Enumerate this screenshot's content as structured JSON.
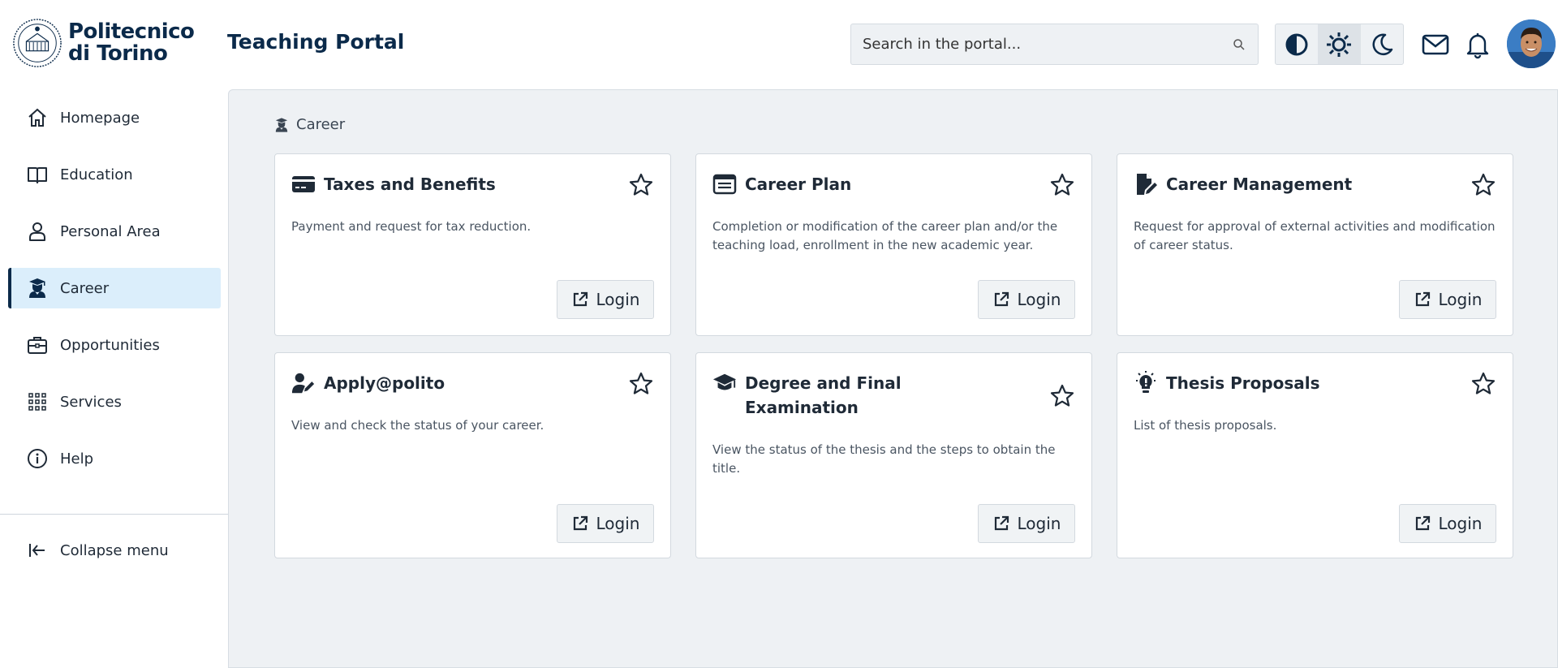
{
  "header": {
    "logo_line1": "Politecnico",
    "logo_line2": "di Torino",
    "portal_title": "Teaching Portal",
    "search_placeholder": "Search in the portal...",
    "theme_modes": [
      "contrast",
      "light",
      "dark"
    ],
    "active_theme": "light"
  },
  "sidebar": {
    "items": [
      {
        "label": "Homepage",
        "icon": "home-icon"
      },
      {
        "label": "Education",
        "icon": "book-icon"
      },
      {
        "label": "Personal Area",
        "icon": "user-icon"
      },
      {
        "label": "Career",
        "icon": "graduate-icon",
        "active": true
      },
      {
        "label": "Opportunities",
        "icon": "briefcase-icon"
      },
      {
        "label": "Services",
        "icon": "grid-icon"
      },
      {
        "label": "Help",
        "icon": "info-icon"
      }
    ],
    "collapse_label": "Collapse menu"
  },
  "main": {
    "breadcrumb": "Career",
    "login_label": "Login",
    "cards": [
      {
        "title": "Taxes and Benefits",
        "description": "Payment and request for tax reduction.",
        "icon": "credit-card-icon"
      },
      {
        "title": "Career Plan",
        "description": "Completion or modification of the career plan and/or the teaching load, enrollment in the new academic year.",
        "icon": "list-card-icon"
      },
      {
        "title": "Career Management",
        "description": "Request for approval of external activities and modification of career status.",
        "icon": "file-edit-icon"
      },
      {
        "title": "Apply@polito",
        "description": "View and check the status of your career.",
        "icon": "user-edit-icon"
      },
      {
        "title": "Degree and Final Examination",
        "description": "View the status of the thesis and the steps to obtain the title.",
        "icon": "graduation-cap-icon"
      },
      {
        "title": "Thesis Proposals",
        "description": "List of thesis proposals.",
        "icon": "lightbulb-icon"
      }
    ]
  },
  "colors": {
    "brand": "#0b2a4a",
    "active_nav_bg": "#dbeefb",
    "main_bg": "#eef1f4"
  }
}
